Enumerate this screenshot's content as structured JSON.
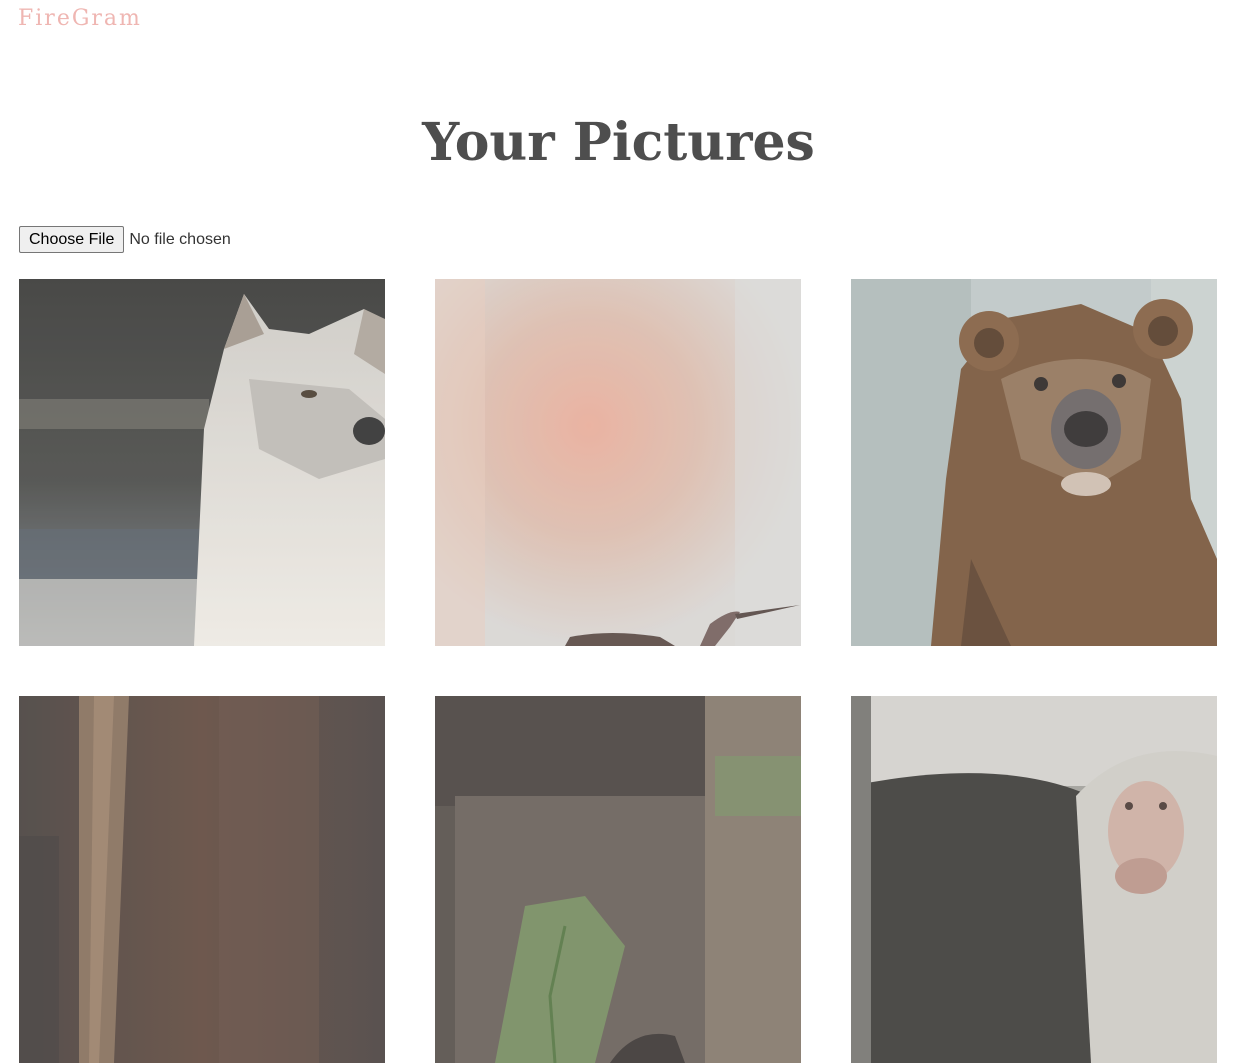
{
  "header": {
    "brand": "FireGram"
  },
  "main": {
    "title": "Your Pictures",
    "upload": {
      "button_label": "Choose File",
      "status": "No file chosen"
    },
    "pictures": [
      {
        "name": "wolf-photo"
      },
      {
        "name": "hummingbird-photo"
      },
      {
        "name": "bear-photo"
      },
      {
        "name": "horse-photo"
      },
      {
        "name": "forest-animal-photo"
      },
      {
        "name": "baboon-photo"
      }
    ]
  },
  "colors": {
    "brand": "#efb6b2",
    "title": "#4e4e4e"
  }
}
